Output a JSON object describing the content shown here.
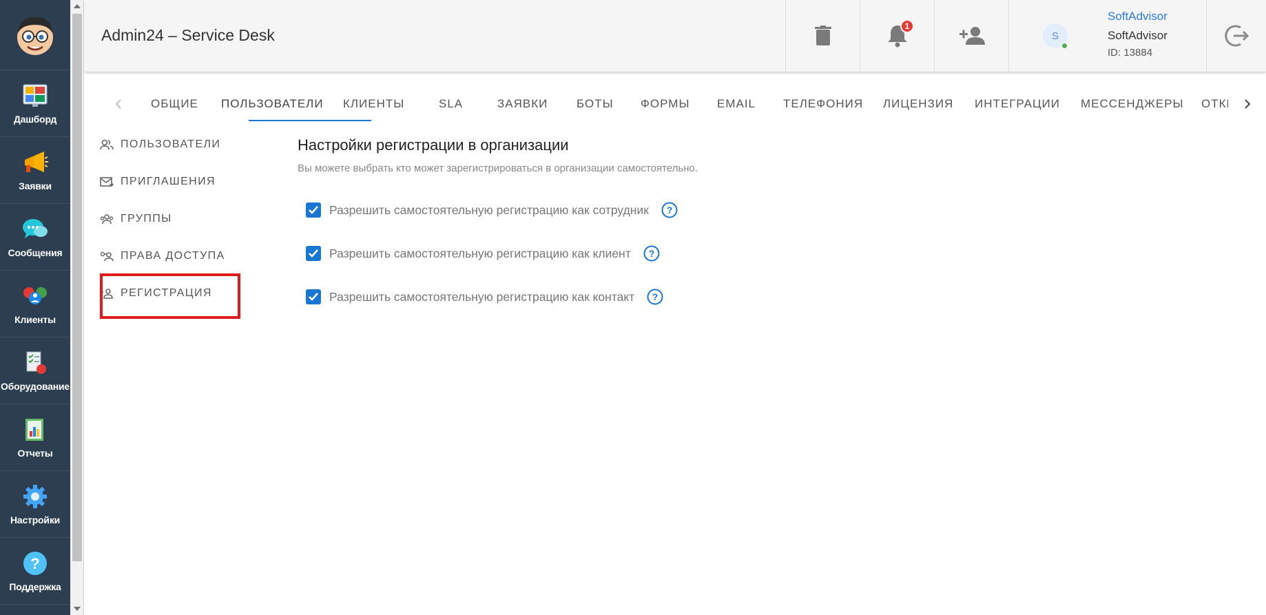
{
  "sidebar": {
    "items": [
      {
        "label": "Дашборд",
        "icon": "dashboard-icon"
      },
      {
        "label": "Заявки",
        "icon": "megaphone-icon"
      },
      {
        "label": "Сообщения",
        "icon": "chat-bubbles-icon"
      },
      {
        "label": "Клиенты",
        "icon": "clients-icon"
      },
      {
        "label": "Оборудование",
        "icon": "equipment-icon"
      },
      {
        "label": "Отчеты",
        "icon": "reports-icon"
      },
      {
        "label": "Настройки",
        "icon": "gear-icon"
      },
      {
        "label": "Поддержка",
        "icon": "support-icon"
      }
    ]
  },
  "header": {
    "title": "Admin24 – Service Desk",
    "notification_count": "1",
    "user": {
      "avatar_letter": "S",
      "link": "SoftAdvisor",
      "name": "SoftAdvisor",
      "id": "ID: 13884"
    }
  },
  "tabs": {
    "items": [
      "ОБЩИЕ",
      "ПОЛЬЗОВАТЕЛИ",
      "КЛИЕНТЫ",
      "SLA",
      "ЗАЯВКИ",
      "БОТЫ",
      "ФОРМЫ",
      "EMAIL",
      "ТЕЛЕФОНИЯ",
      "ЛИЦЕНЗИЯ",
      "ИНТЕГРАЦИИ",
      "МЕССЕНДЖЕРЫ",
      "ОТКРЫТЫЕ"
    ],
    "active": "ПОЛЬЗОВАТЕЛИ"
  },
  "submenu": {
    "items": [
      "ПОЛЬЗОВАТЕЛИ",
      "ПРИГЛАШЕНИЯ",
      "ГРУППЫ",
      "ПРАВА ДОСТУПА",
      "РЕГИСТРАЦИЯ"
    ],
    "active": "РЕГИСТРАЦИЯ"
  },
  "content": {
    "title": "Настройки регистрации в организации",
    "subtitle": "Вы можете выбрать кто может зарегистрироваться в организации самостоятельно.",
    "options": [
      {
        "label": "Разрешить самостоятельную регистрацию как сотрудник",
        "checked": true
      },
      {
        "label": "Разрешить самостоятельную регистрацию как клиент",
        "checked": true
      },
      {
        "label": "Разрешить самостоятельную регистрацию как контакт",
        "checked": true
      }
    ]
  },
  "colors": {
    "sidebar_bg": "#2c3e50",
    "accent": "#1976d2",
    "highlight": "#e01b1b",
    "badge": "#e53935"
  }
}
